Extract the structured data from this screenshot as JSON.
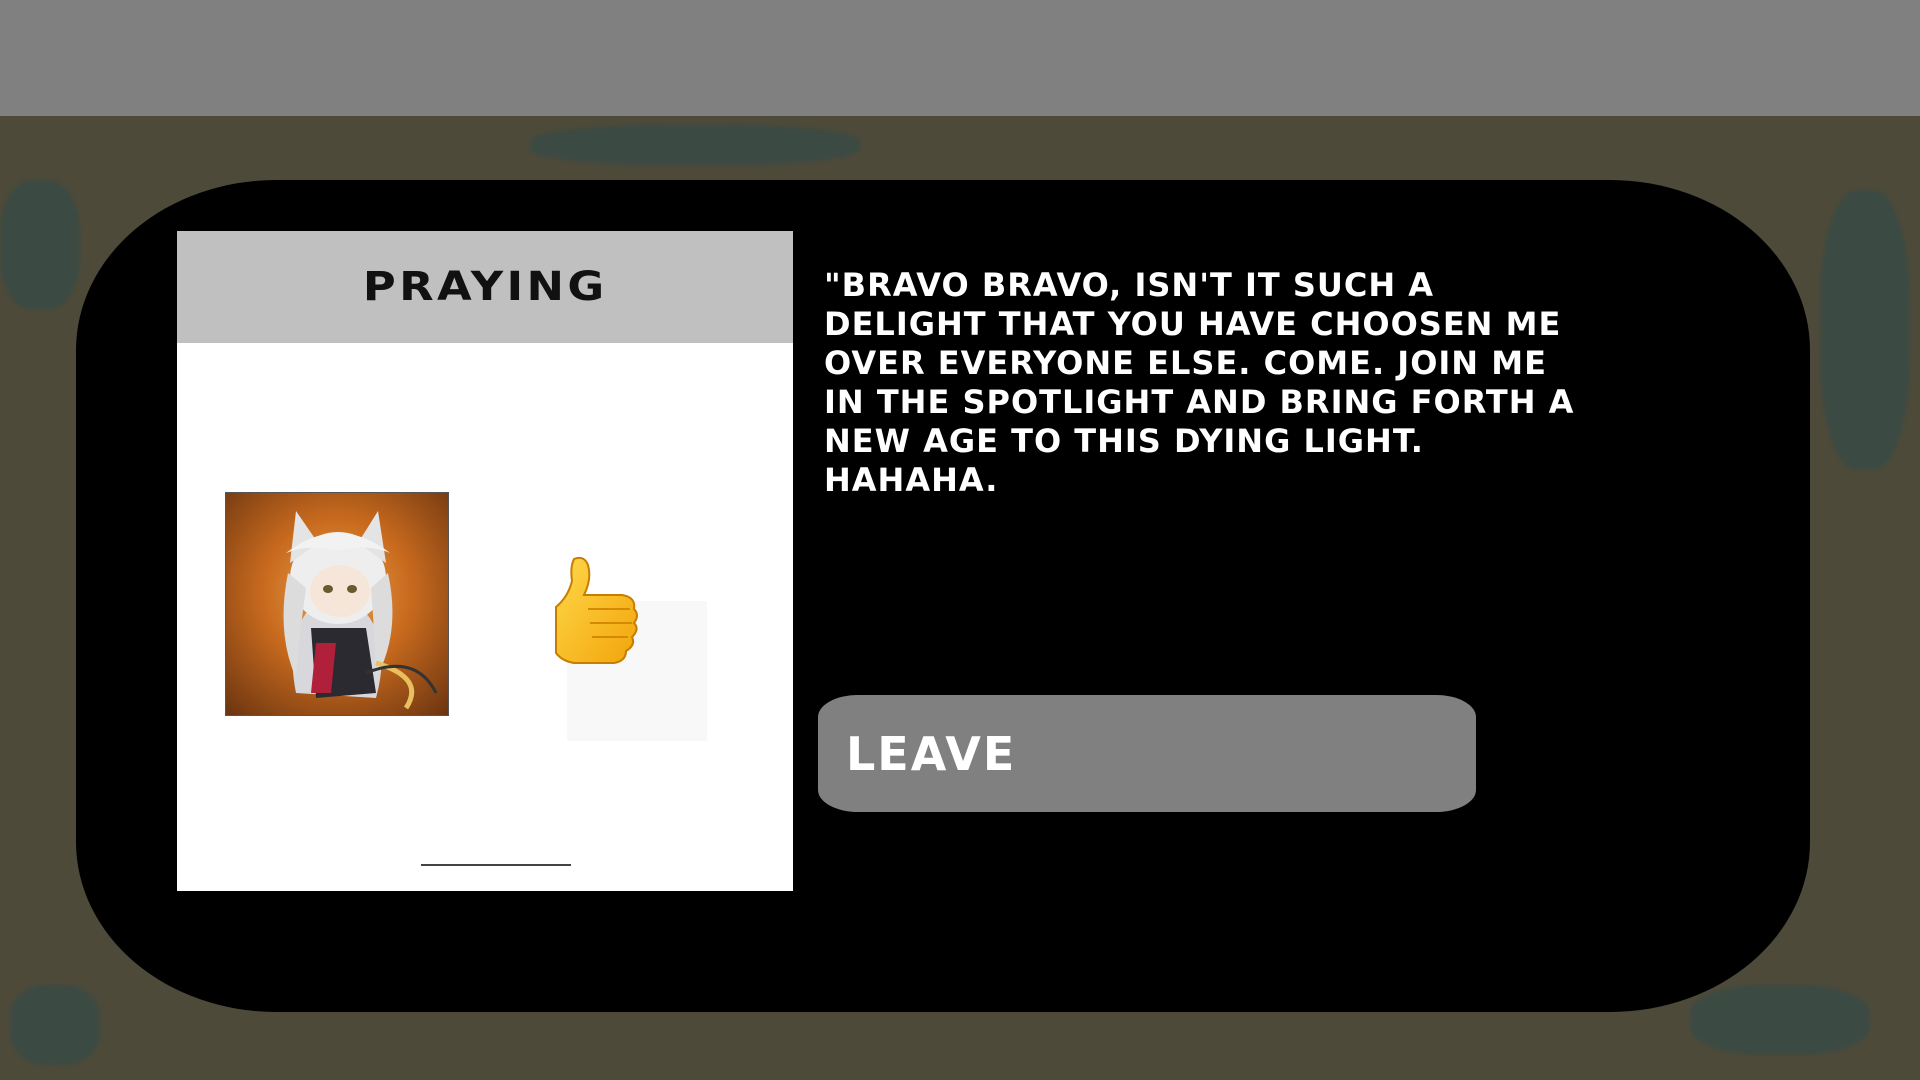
{
  "card": {
    "title": "PRAYING",
    "portrait_icon": "character-portrait",
    "reaction_icon": "thumbs-up-icon"
  },
  "dialogue": {
    "text": "\"BRAVO BRAVO, ISN'T IT SUCH A DELIGHT THAT YOU HAVE CHOOSEN ME OVER EVERYONE ELSE. COME. JOIN ME IN THE SPOTLIGHT AND BRING FORTH A NEW AGE TO THIS DYING LIGHT. HAHAHA."
  },
  "actions": {
    "leave_label": "LEAVE"
  },
  "colors": {
    "background": "#4e4a39",
    "top_bar": "#808080",
    "panel": "#000000",
    "card_header": "#c0c0c0",
    "button": "#808080"
  }
}
